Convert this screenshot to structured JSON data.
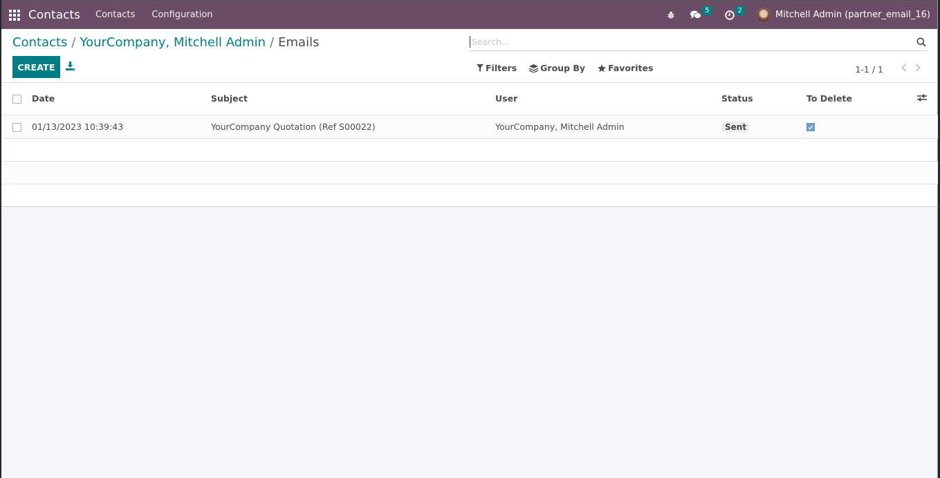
{
  "navbar": {
    "app_name": "Contacts",
    "menus": [
      "Contacts",
      "Configuration"
    ],
    "messages_badge": "5",
    "activities_badge": "2",
    "user_name": "Mitchell Admin (partner_email_16)",
    "bg_color": "#6b4c66"
  },
  "breadcrumb": {
    "items": [
      "Contacts",
      "YourCompany, Mitchell Admin"
    ],
    "separator": "/",
    "current": "Emails"
  },
  "toolbar": {
    "create_label": "CREATE",
    "accent_color": "#017e84"
  },
  "search": {
    "placeholder": "Search...",
    "value": "",
    "filters_label": "Filters",
    "group_by_label": "Group By",
    "favorites_label": "Favorites"
  },
  "pager": {
    "value": "1-1 / 1"
  },
  "table": {
    "columns": [
      "Date",
      "Subject",
      "User",
      "Status",
      "To Delete"
    ],
    "rows": [
      {
        "date": "01/13/2023 10:39:43",
        "subject": "YourCompany Quotation (Ref S00022)",
        "user": "YourCompany, Mitchell Admin",
        "status": "Sent",
        "to_delete": true
      }
    ]
  }
}
